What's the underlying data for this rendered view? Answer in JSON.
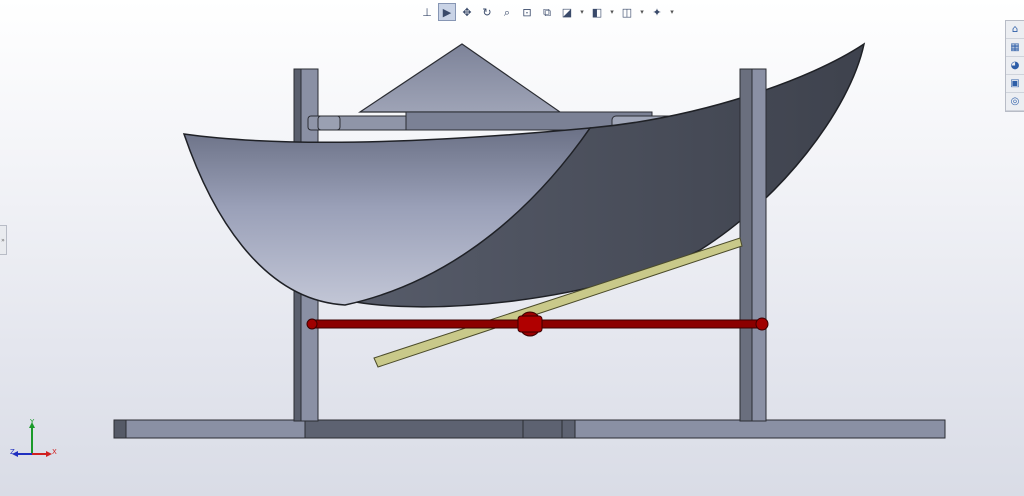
{
  "heads_up_toolbar": {
    "items": [
      {
        "name": "view-orientation",
        "glyph": "⊥"
      },
      {
        "name": "select",
        "glyph": "▶",
        "active": true
      },
      {
        "name": "pan",
        "glyph": "✥"
      },
      {
        "name": "rotate",
        "glyph": "↻"
      },
      {
        "name": "zoom-to-fit",
        "glyph": "⌕"
      },
      {
        "name": "zoom-to-area",
        "glyph": "⊡"
      },
      {
        "name": "previous-view",
        "glyph": "⧉"
      },
      {
        "name": "section-view",
        "glyph": "◪"
      },
      {
        "name": "display-style",
        "glyph": "◧"
      },
      {
        "name": "hide-show-items",
        "glyph": "◫"
      },
      {
        "name": "view-settings",
        "glyph": "✦"
      }
    ]
  },
  "task_pane": {
    "items": [
      {
        "name": "resources-icon",
        "glyph": "⌂"
      },
      {
        "name": "design-library-icon",
        "glyph": "▦"
      },
      {
        "name": "appearances-icon",
        "glyph": "◕"
      },
      {
        "name": "view-palette-icon",
        "glyph": "▣"
      },
      {
        "name": "file-explorer-icon",
        "glyph": "◎"
      }
    ]
  },
  "triad": {
    "x": "X",
    "y": "Y",
    "z": "Z"
  },
  "colors": {
    "frame": "#8a90a4",
    "dish_inner": "#a3a9c0",
    "dish_outer": "#4a4f5c",
    "shaft": "#8b0000",
    "link_bar": "#c9c98a"
  }
}
